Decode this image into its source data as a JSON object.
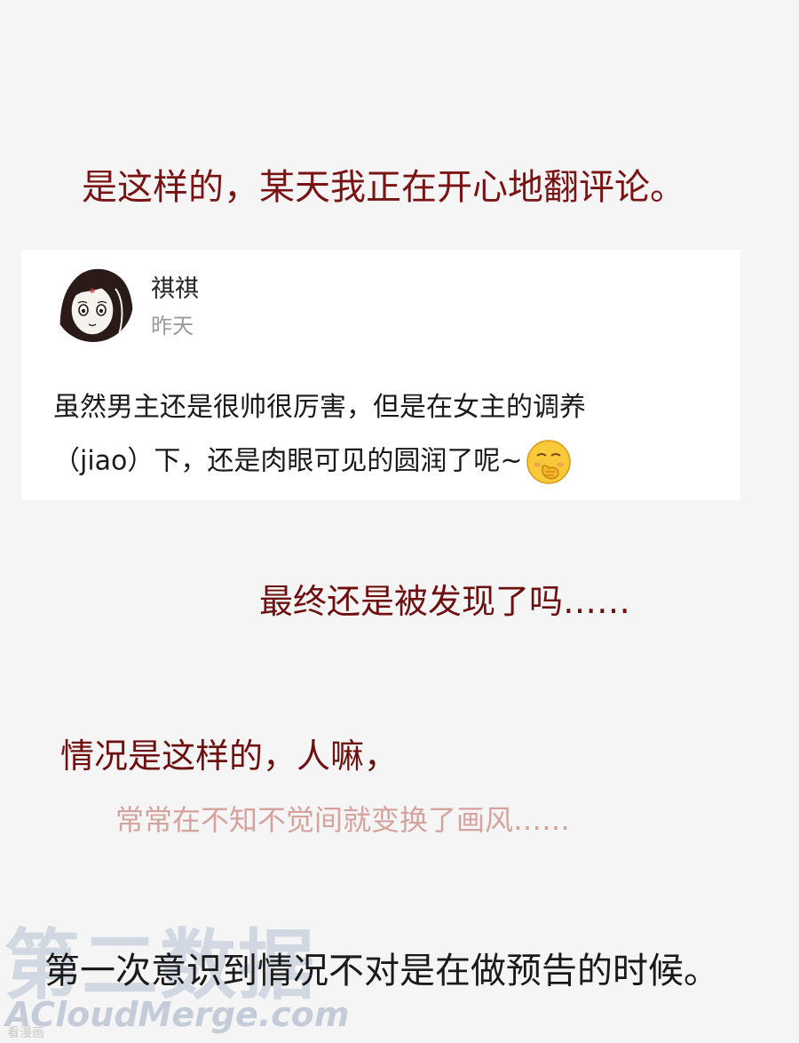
{
  "lines": {
    "line1": "是这样的，某天我正在开心地翻评论。",
    "line2": "最终还是被发现了吗……",
    "line3": "情况是这样的，人嘛，",
    "line4": "常常在不知不觉间就变换了画风……",
    "line5": "第一次意识到情况不对是在做预告的时候。"
  },
  "comment_card": {
    "username": "祺祺",
    "time": "昨天",
    "text_line1": "虽然男主还是很帅很厉害，但是在女主的调养",
    "text_line2": "（jiao）下，还是肉眼可见的圆润了呢~",
    "emoji": "blush-hand-over-mouth-emoji"
  },
  "watermark": {
    "chinese": "第二数据",
    "english": "ACloudMerge.com",
    "small": "看漫画"
  },
  "colors": {
    "background": "#f5f5f5",
    "dark_red": "#6e1010",
    "pink": "#d6a29e",
    "black": "#1a1a1a"
  }
}
